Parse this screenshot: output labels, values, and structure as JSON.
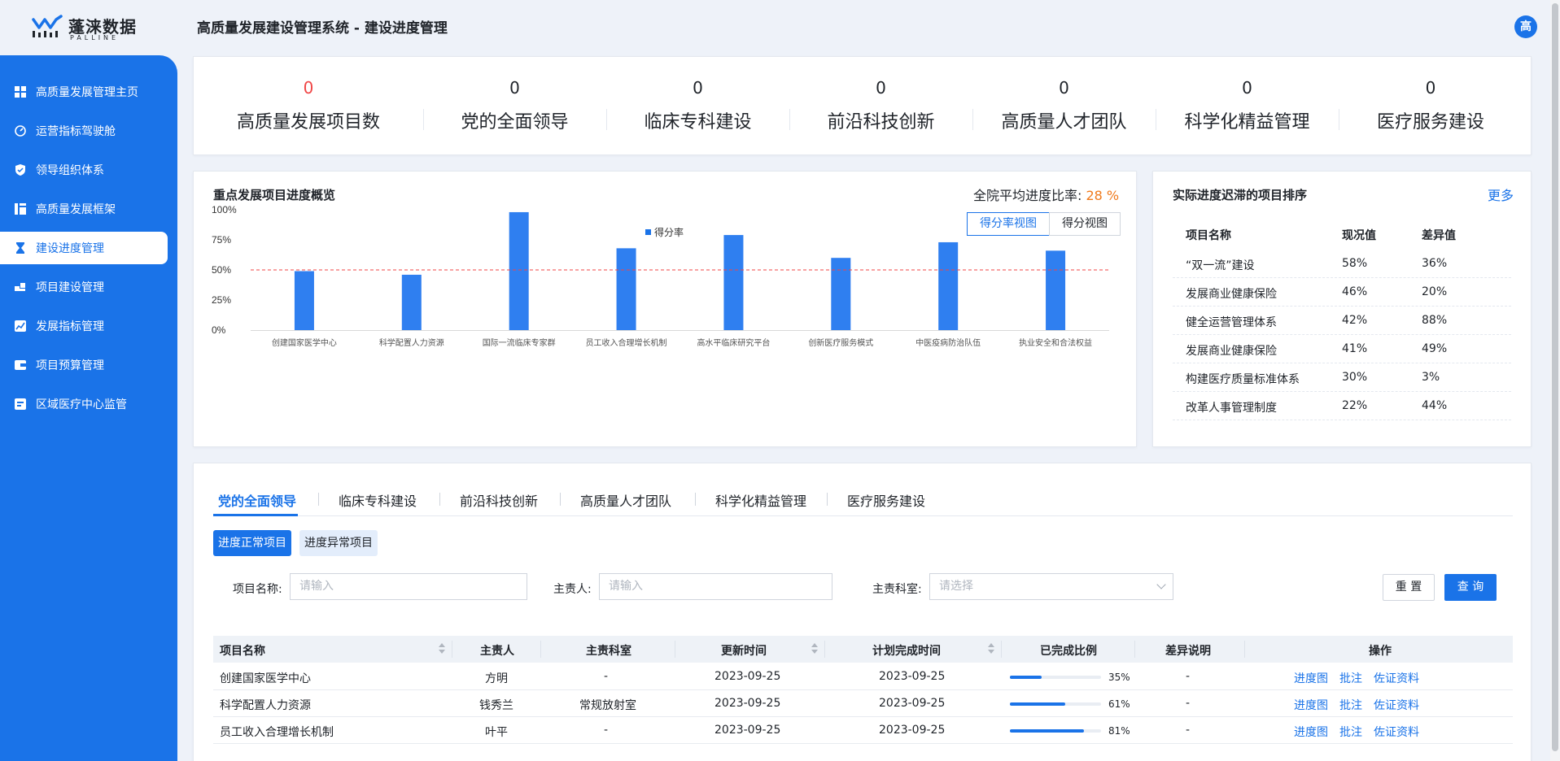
{
  "header": {
    "logo_cn": "蓬涞数据",
    "logo_en": "PALLINE",
    "title": "高质量发展建设管理系统 - 建设进度管理",
    "avatar_text": "高",
    "accent": "#1a73e8"
  },
  "sidebar": {
    "items": [
      {
        "label": "高质量发展管理主页",
        "icon": "dashboard-grid-icon"
      },
      {
        "label": "运营指标驾驶舱",
        "icon": "gauge-icon"
      },
      {
        "label": "领导组织体系",
        "icon": "shield-icon"
      },
      {
        "label": "高质量发展框架",
        "icon": "layout-icon"
      },
      {
        "label": "建设进度管理",
        "icon": "hourglass-icon",
        "active": true
      },
      {
        "label": "项目建设管理",
        "icon": "blocks-icon"
      },
      {
        "label": "发展指标管理",
        "icon": "trend-chart-icon"
      },
      {
        "label": "项目预算管理",
        "icon": "wallet-icon"
      },
      {
        "label": "区域医疗中心监管",
        "icon": "monitor-icon"
      }
    ]
  },
  "stats": [
    {
      "value": "0",
      "label": "高质量发展项目数"
    },
    {
      "value": "0",
      "label": "党的全面领导"
    },
    {
      "value": "0",
      "label": "临床专科建设"
    },
    {
      "value": "0",
      "label": "前沿科技创新"
    },
    {
      "value": "0",
      "label": "高质量人才团队"
    },
    {
      "value": "0",
      "label": "科学化精益管理"
    },
    {
      "value": "0",
      "label": "医疗服务建设"
    }
  ],
  "overview": {
    "title": "重点发展项目进度概览",
    "avg_label": "全院平均进度比率: ",
    "avg_value": "28 %",
    "view_rate": "得分率视图",
    "view_score": "得分视图"
  },
  "chart_data": {
    "type": "bar",
    "categories": [
      "创建国家医学中心",
      "科学配置人力资源",
      "国际一流临床专家群",
      "员工收入合理增长机制",
      "高水平临床研究平台",
      "创新医疗服务模式",
      "中医疫病防治队伍",
      "执业安全和合法权益"
    ],
    "series": [
      {
        "name": "得分率",
        "values": [
          49,
          46,
          98,
          68,
          79,
          60,
          73,
          66
        ]
      }
    ],
    "ylim": [
      0,
      100
    ],
    "yticks": [
      "0%",
      "25%",
      "50%",
      "75%",
      "100%"
    ],
    "reference_line": 50,
    "reference_color": "#f04646",
    "bar_color": "#2f7ff0",
    "grid": false,
    "legend_position": "top-center"
  },
  "ranking": {
    "title": "实际进度迟滞的项目排序",
    "more": "更多",
    "columns": [
      "项目名称",
      "现况值",
      "差异值"
    ],
    "rows": [
      [
        "“双一流”建设",
        "58%",
        "36%"
      ],
      [
        "发展商业健康保险",
        "46%",
        "20%"
      ],
      [
        "健全运营管理体系",
        "42%",
        "88%"
      ],
      [
        "发展商业健康保险",
        "41%",
        "49%"
      ],
      [
        "构建医疗质量标准体系",
        "30%",
        "3%"
      ],
      [
        "改革人事管理制度",
        "22%",
        "44%"
      ]
    ]
  },
  "detail": {
    "tabs": [
      "党的全面领导",
      "临床专科建设",
      "前沿科技创新",
      "高质量人才团队",
      "科学化精益管理",
      "医疗服务建设"
    ],
    "pill_normal": "进度正常项目",
    "pill_abnormal": "进度异常项目",
    "filters": {
      "name_label": "项目名称:",
      "name_placeholder": "请输入",
      "owner_label": "主责人:",
      "owner_placeholder": "请输入",
      "dept_label": "主责科室:",
      "dept_placeholder": "请选择"
    },
    "reset": "重 置",
    "search": "查 询",
    "columns": [
      "项目名称",
      "主责人",
      "主责科室",
      "更新时间",
      "计划完成时间",
      "已完成比例",
      "差异说明",
      "操作"
    ],
    "rows": [
      {
        "name": "创建国家医学中心",
        "owner": "方明",
        "dept": "-",
        "updated": "2023-09-25",
        "planned": "2023-09-25",
        "pct": 35,
        "pct_label": "35%",
        "diff": "-"
      },
      {
        "name": "科学配置人力资源",
        "owner": "钱秀兰",
        "dept": "常规放射室",
        "updated": "2023-09-25",
        "planned": "2023-09-25",
        "pct": 61,
        "pct_label": "61%",
        "diff": "-"
      },
      {
        "name": "员工收入合理增长机制",
        "owner": "叶平",
        "dept": "-",
        "updated": "2023-09-25",
        "planned": "2023-09-25",
        "pct": 81,
        "pct_label": "81%",
        "diff": "-"
      }
    ],
    "ops": [
      "进度图",
      "批注",
      "佐证资料"
    ]
  }
}
